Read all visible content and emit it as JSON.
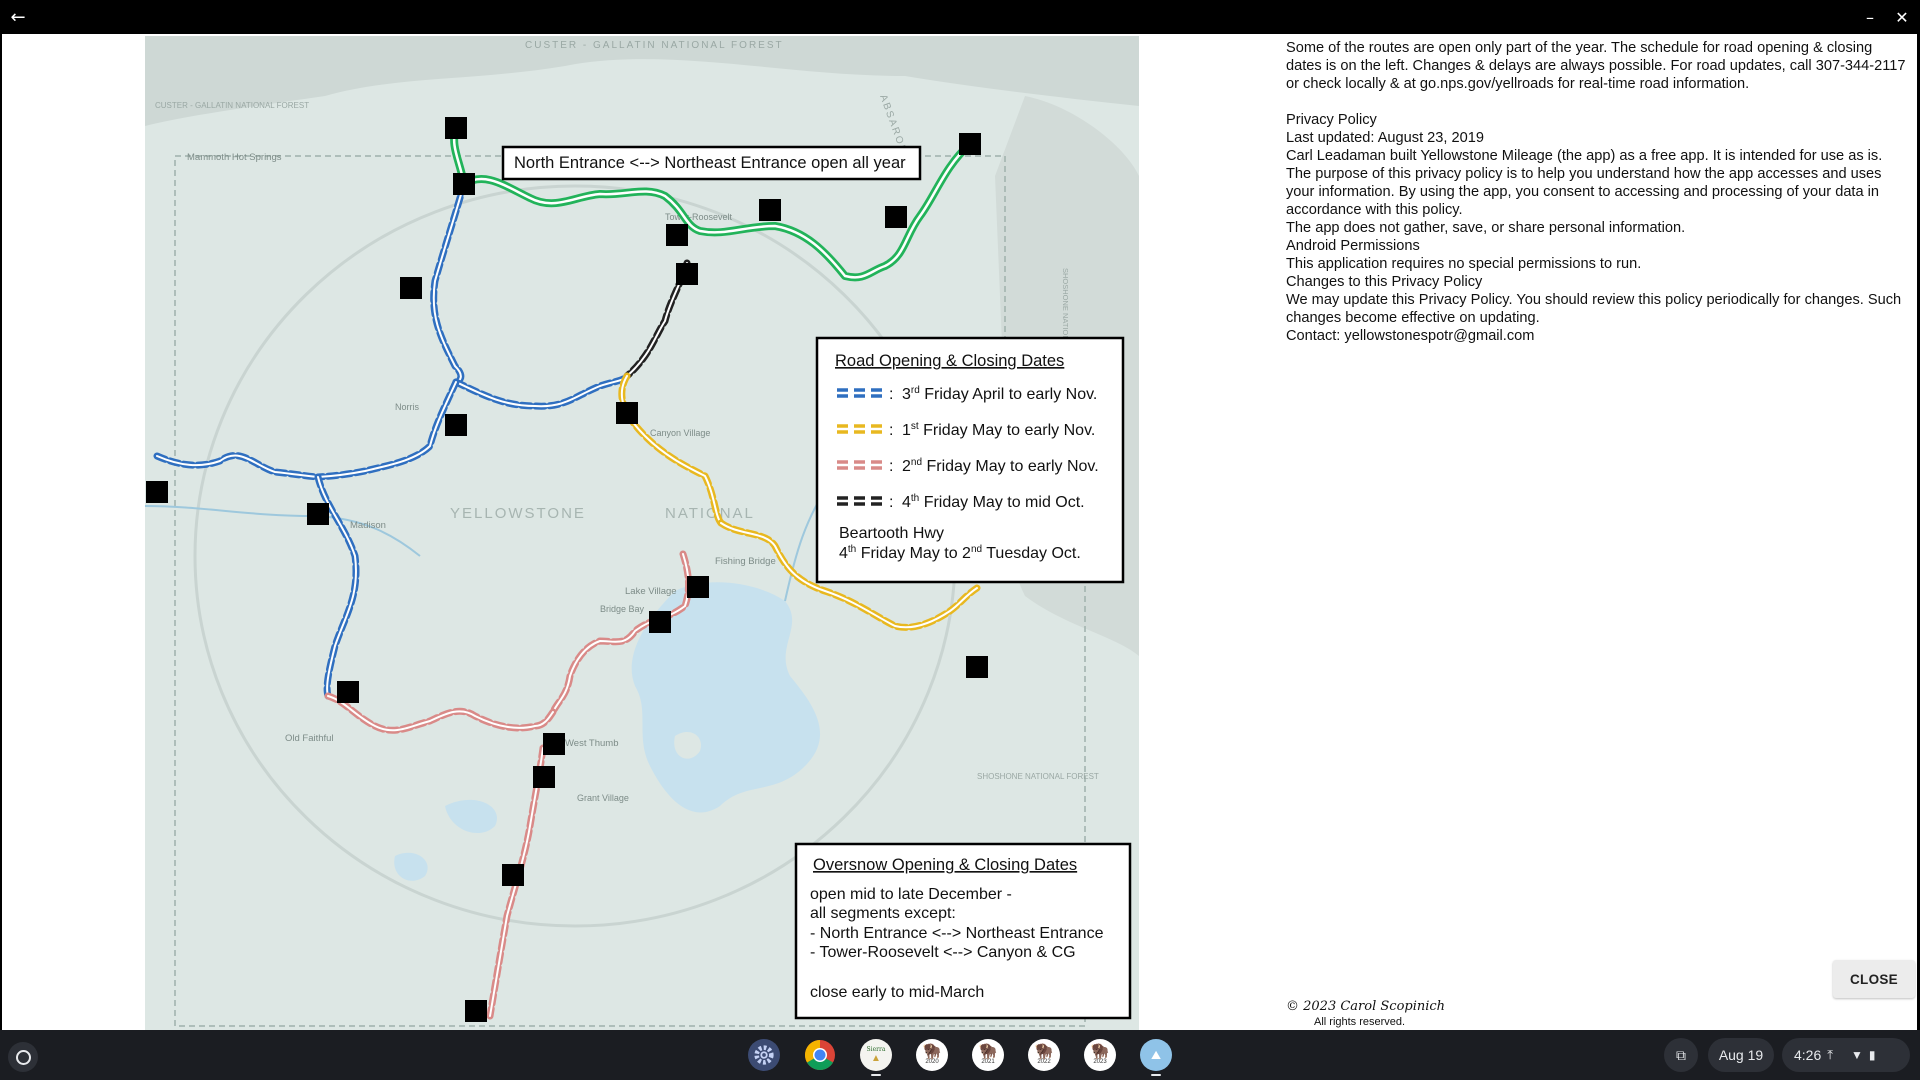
{
  "window": {
    "back_icon": "arrow-left-icon",
    "minimize_icon": "minimize-icon",
    "close_icon": "close-icon"
  },
  "map": {
    "north_banner": "North Entrance <--> Northeast Entrance open all year",
    "labels": {
      "custer": "CUSTER - GALLATIN NATIONAL FOREST",
      "custer_left": "CUSTER - GALLATIN NATIONAL FOREST",
      "absaroka": "ABSAROKA",
      "mammoth": "Mammoth Hot Springs",
      "tower": "Tower-Roosevelt",
      "norris": "Norris",
      "canyon": "Canyon Village",
      "yellowstone": "YELLOWSTONE",
      "national": "NATIONAL",
      "madison": "Madison",
      "fishing_bridge": "Fishing Bridge",
      "lake_village": "Lake Village",
      "bridge_bay": "Bridge Bay",
      "old_faithful": "Old Faithful",
      "west_thumb": "West Thumb",
      "grant_village": "Grant Village",
      "shoshone": "SHOSHONE NATIONAL FOREST",
      "shoshone_ne": "SHOSHONE NATIONAL FOREST"
    },
    "road_legend": {
      "title": "Road Opening & Closing Dates",
      "rows": [
        {
          "color": "#2f6fc0",
          "ord": "3",
          "sup": "rd",
          "text": " Friday April to early Nov."
        },
        {
          "color": "#e8b820",
          "ord": "1",
          "sup": "st",
          "text": " Friday May to early Nov."
        },
        {
          "color": "#d98a88",
          "ord": "2",
          "sup": "nd",
          "text": " Friday May to early Nov."
        },
        {
          "color": "#222222",
          "ord": "4",
          "sup": "th",
          "text": " Friday May to mid Oct."
        }
      ],
      "beartooth_title": "Beartooth Hwy",
      "beartooth_ord1": "4",
      "beartooth_sup1": "th",
      "beartooth_mid": " Friday May to 2",
      "beartooth_sup2": "nd",
      "beartooth_end": " Tuesday Oct."
    },
    "oversnow": {
      "title": "Oversnow Opening & Closing Dates",
      "line1": "open mid to late December  -",
      "line2": "all segments except:",
      "line3": "- North Entrance <--> Northeast Entrance",
      "line4": "- Tower-Roosevelt <--> Canyon & CG",
      "line5": "close early to mid-March"
    },
    "colors": {
      "north_route": "#22b35a",
      "spring_route": "#2f6fc0",
      "may_route": "#e8b820",
      "south_route": "#d98a88",
      "dunraven_route": "#222222"
    }
  },
  "privacy": {
    "schedule": "Some of the routes are open only part of the year. The schedule for road opening & closing dates is on the left. Changes & delays are always possible. For road updates, call 307-344-2117 or check locally & at go.nps.gov/yellroads for real-time road information.",
    "title": "Privacy Policy",
    "updated": "Last updated: August 23, 2019",
    "intro": "Carl Leadaman built Yellowstone Mileage (the app) as a free app. It is intended for use as is. The purpose of this privacy policy is to help you understand how the app accesses and uses your information. By using the app, you consent to accessing and processing of your data in accordance with this policy.",
    "no_gather": "The app does not gather, save, or share personal information.",
    "perm_title": "Android Permissions",
    "perm_text": "This application requires no special permissions to run.",
    "changes_title": "Changes to this Privacy Policy",
    "changes_text": "We may update this Privacy Policy. You should review this policy periodically for changes. Such changes become effective on updating.",
    "contact": "Contact: yellowstonespotr@gmail.com"
  },
  "close_label": "CLOSE",
  "copyright": "© 2023 Carol Scopinich",
  "rights": "All rights reserved.",
  "shelf": {
    "apps": [
      {
        "name": "settings-app-icon",
        "badge": ""
      },
      {
        "name": "chrome-app-icon",
        "badge": ""
      },
      {
        "name": "sierra-app-icon",
        "badge": "Sierra"
      },
      {
        "name": "yellowstone-2020-app-icon",
        "badge": "2020"
      },
      {
        "name": "yellowstone-2021-app-icon",
        "badge": "2021"
      },
      {
        "name": "yellowstone-2022-app-icon",
        "badge": "2022"
      },
      {
        "name": "yellowstone-2023-app-icon",
        "badge": "2023"
      },
      {
        "name": "yosemite-app-icon",
        "badge": ""
      }
    ],
    "date": "Aug 19",
    "time": "4:26"
  }
}
